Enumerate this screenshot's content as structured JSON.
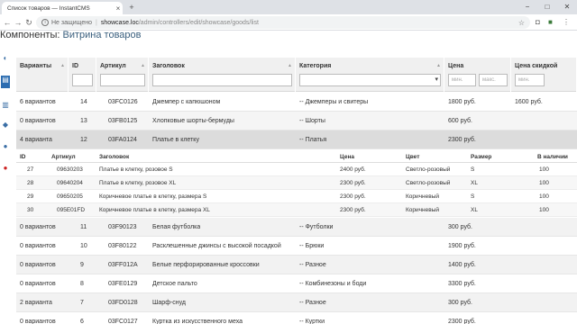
{
  "browser": {
    "tab_title": "Список товаров — InstantCMS",
    "tab_close": "×",
    "new_tab": "+",
    "security_label": "Не защищено",
    "url_host": "showcase.loc",
    "url_path": "/admin/controllers/edit/showcase/goods/list",
    "window_controls": [
      "−",
      "□",
      "✕"
    ],
    "separator": "|"
  },
  "page": {
    "breadcrumb": "Компоненты",
    "breadcrumb_separator": ":",
    "title": "Витрина товаров"
  },
  "grid": {
    "columns": [
      {
        "label": "Варианты",
        "sortable": true
      },
      {
        "label": "ID",
        "sortable": false
      },
      {
        "label": "Артикул",
        "sortable": true
      },
      {
        "label": "Заголовок",
        "sortable": true
      },
      {
        "label": "Категория",
        "sortable": true
      },
      {
        "label": "Цена",
        "sortable": false
      },
      {
        "label": "Цена скидкой",
        "sortable": false
      }
    ],
    "price_min_placeholder": "мин.",
    "price_max_placeholder": "макс.",
    "discount_min_placeholder": "мин.",
    "rows_top": [
      {
        "variants": "6 вариантов",
        "id": "14",
        "sku": "03FC0126",
        "title": "Джемпер с капюшоном",
        "category": "-- Джемперы и свитеры",
        "price": "1800 руб.",
        "discount": "1600 руб."
      },
      {
        "variants": "0 вариантов",
        "id": "13",
        "sku": "03FB0125",
        "title": "Хлопковые шорты-бермуды",
        "category": "-- Шорты",
        "price": "600 руб.",
        "discount": ""
      },
      {
        "variants": "4 варианта",
        "id": "12",
        "sku": "03FA0124",
        "title": "Платье в клетку",
        "category": "-- Платья",
        "price": "2300 руб.",
        "discount": ""
      }
    ],
    "rows_bottom": [
      {
        "variants": "0 вариантов",
        "id": "11",
        "sku": "03F90123",
        "title": "Белая футболка",
        "category": "-- Футболки",
        "price": "300 руб.",
        "discount": ""
      },
      {
        "variants": "0 вариантов",
        "id": "10",
        "sku": "03F80122",
        "title": "Расклешенные джинсы с высокой посадкой",
        "category": "-- Брюки",
        "price": "1900 руб.",
        "discount": ""
      },
      {
        "variants": "0 вариантов",
        "id": "9",
        "sku": "03FF012A",
        "title": "Белые перфорированные кроссовки",
        "category": "-- Разное",
        "price": "1400 руб.",
        "discount": ""
      },
      {
        "variants": "0 вариантов",
        "id": "8",
        "sku": "03FE0129",
        "title": "Детское пальто",
        "category": "-- Комбинезоны и боди",
        "price": "3300 руб.",
        "discount": ""
      },
      {
        "variants": "2 варианта",
        "id": "7",
        "sku": "03FD0128",
        "title": "Шарф-снуд",
        "category": "-- Разное",
        "price": "300 руб.",
        "discount": ""
      },
      {
        "variants": "0 вариантов",
        "id": "6",
        "sku": "03FC0127",
        "title": "Куртка из искусственного меха",
        "category": "-- Куртки",
        "price": "2300 руб.",
        "discount": ""
      }
    ]
  },
  "variants_table": {
    "columns": [
      "ID",
      "Артикул",
      "Заголовок",
      "Цена",
      "Цвет",
      "Размер",
      "В наличии"
    ],
    "rows": [
      {
        "id": "27",
        "sku": "09630203",
        "title": "Платье в клетку, розовое S",
        "price": "2400 руб.",
        "color": "Светло-розовый",
        "size": "S",
        "stock": "100"
      },
      {
        "id": "28",
        "sku": "09640204",
        "title": "Платье в клетку, розовое XL",
        "price": "2300 руб.",
        "color": "Светло-розовый",
        "size": "XL",
        "stock": "100"
      },
      {
        "id": "29",
        "sku": "09650205",
        "title": "Коричневое платье в клетку, размера S",
        "price": "2300 руб.",
        "color": "Коричневый",
        "size": "S",
        "stock": "100"
      },
      {
        "id": "30",
        "sku": "095E01FD",
        "title": "Коричневое платье в клетку, размера XL",
        "price": "2300 руб.",
        "color": "Коричневый",
        "size": "XL",
        "stock": "100"
      }
    ]
  },
  "colors": {
    "accent": "#3a5f7e",
    "header_bg": "#f0f0f0",
    "selected_row": "#dcdcdc",
    "overlay": "#9e9e9e"
  },
  "icons": [
    "back-icon",
    "forward-icon",
    "reload-icon",
    "info-icon",
    "star-icon",
    "camera-icon",
    "extension-icon",
    "menu-icon"
  ]
}
